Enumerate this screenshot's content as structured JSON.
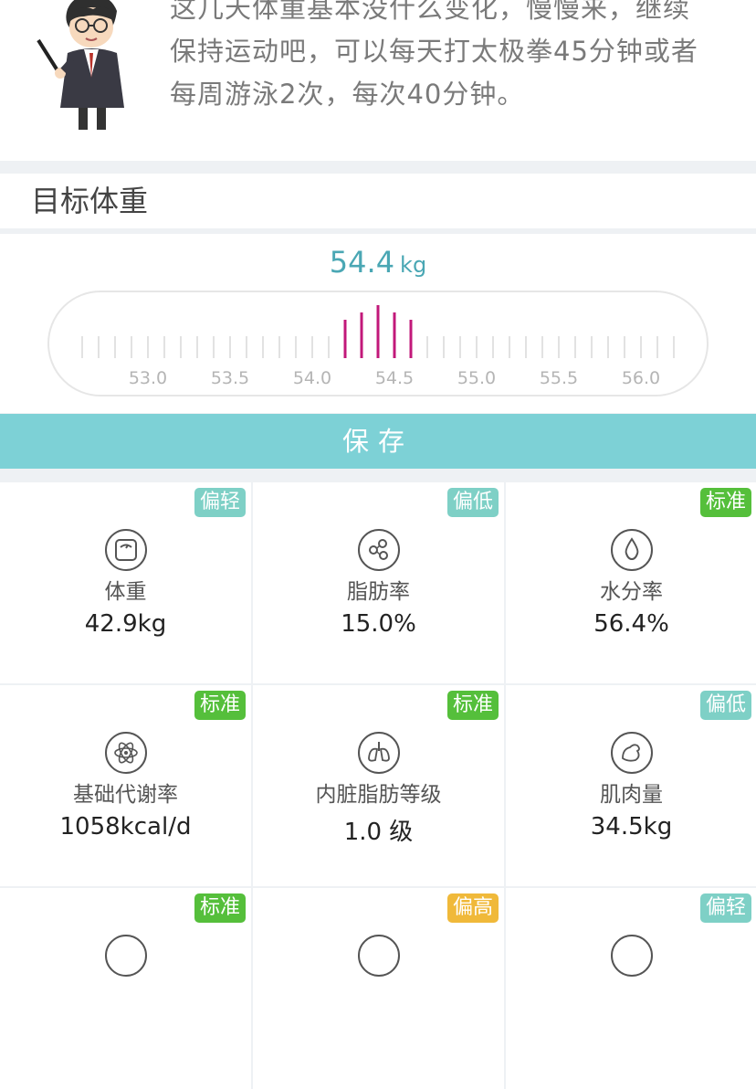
{
  "tip": {
    "line1": "这几天体重基本没什么变化，慢慢来，继续",
    "line2": "保持运动吧，可以每天打太极拳45分钟或者",
    "line3": "每周游泳2次，每次40分钟。"
  },
  "target": {
    "title": "目标体重",
    "value": "54.4",
    "unit": "kg",
    "selected": 54.4,
    "ticks": [
      "53.0",
      "53.5",
      "54.0",
      "54.5",
      "55.0",
      "55.5",
      "56.0"
    ]
  },
  "save_label": "保存",
  "colors": {
    "accent": "#4aa7b4",
    "save_bg": "#7dd1d6",
    "ruler_active": "#c2187a",
    "badge_light": "#7ed0c6",
    "badge_standard": "#55bf3b",
    "badge_high": "#f0b93a"
  },
  "metrics": [
    {
      "badge": "偏轻",
      "badge_type": "light",
      "icon": "scale-icon",
      "label": "体重",
      "value": "42.9kg"
    },
    {
      "badge": "偏低",
      "badge_type": "light",
      "icon": "molecule-icon",
      "label": "脂肪率",
      "value": "15.0%"
    },
    {
      "badge": "标准",
      "badge_type": "std",
      "icon": "water-drop-icon",
      "label": "水分率",
      "value": "56.4%"
    },
    {
      "badge": "标准",
      "badge_type": "std",
      "icon": "atom-icon",
      "label": "基础代谢率",
      "value": "1058kcal/d"
    },
    {
      "badge": "标准",
      "badge_type": "std",
      "icon": "lungs-icon",
      "label": "内脏脂肪等级",
      "value": "1.0 级"
    },
    {
      "badge": "偏低",
      "badge_type": "light",
      "icon": "muscle-icon",
      "label": "肌肉量",
      "value": "34.5kg"
    },
    {
      "badge": "标准",
      "badge_type": "std",
      "icon": "bone-icon",
      "label": "",
      "value": ""
    },
    {
      "badge": "偏高",
      "badge_type": "high",
      "icon": "body-icon",
      "label": "",
      "value": ""
    },
    {
      "badge": "偏轻",
      "badge_type": "light",
      "icon": "report-icon",
      "label": "",
      "value": ""
    }
  ]
}
